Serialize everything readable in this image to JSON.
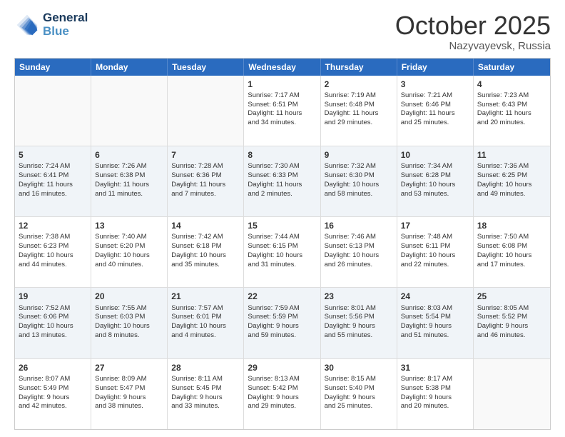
{
  "logo": {
    "line1": "General",
    "line2": "Blue"
  },
  "title": "October 2025",
  "location": "Nazyvayevsk, Russia",
  "days_of_week": [
    "Sunday",
    "Monday",
    "Tuesday",
    "Wednesday",
    "Thursday",
    "Friday",
    "Saturday"
  ],
  "weeks": [
    [
      {
        "day": "",
        "text": ""
      },
      {
        "day": "",
        "text": ""
      },
      {
        "day": "",
        "text": ""
      },
      {
        "day": "1",
        "text": "Sunrise: 7:17 AM\nSunset: 6:51 PM\nDaylight: 11 hours\nand 34 minutes."
      },
      {
        "day": "2",
        "text": "Sunrise: 7:19 AM\nSunset: 6:48 PM\nDaylight: 11 hours\nand 29 minutes."
      },
      {
        "day": "3",
        "text": "Sunrise: 7:21 AM\nSunset: 6:46 PM\nDaylight: 11 hours\nand 25 minutes."
      },
      {
        "day": "4",
        "text": "Sunrise: 7:23 AM\nSunset: 6:43 PM\nDaylight: 11 hours\nand 20 minutes."
      }
    ],
    [
      {
        "day": "5",
        "text": "Sunrise: 7:24 AM\nSunset: 6:41 PM\nDaylight: 11 hours\nand 16 minutes."
      },
      {
        "day": "6",
        "text": "Sunrise: 7:26 AM\nSunset: 6:38 PM\nDaylight: 11 hours\nand 11 minutes."
      },
      {
        "day": "7",
        "text": "Sunrise: 7:28 AM\nSunset: 6:36 PM\nDaylight: 11 hours\nand 7 minutes."
      },
      {
        "day": "8",
        "text": "Sunrise: 7:30 AM\nSunset: 6:33 PM\nDaylight: 11 hours\nand 2 minutes."
      },
      {
        "day": "9",
        "text": "Sunrise: 7:32 AM\nSunset: 6:30 PM\nDaylight: 10 hours\nand 58 minutes."
      },
      {
        "day": "10",
        "text": "Sunrise: 7:34 AM\nSunset: 6:28 PM\nDaylight: 10 hours\nand 53 minutes."
      },
      {
        "day": "11",
        "text": "Sunrise: 7:36 AM\nSunset: 6:25 PM\nDaylight: 10 hours\nand 49 minutes."
      }
    ],
    [
      {
        "day": "12",
        "text": "Sunrise: 7:38 AM\nSunset: 6:23 PM\nDaylight: 10 hours\nand 44 minutes."
      },
      {
        "day": "13",
        "text": "Sunrise: 7:40 AM\nSunset: 6:20 PM\nDaylight: 10 hours\nand 40 minutes."
      },
      {
        "day": "14",
        "text": "Sunrise: 7:42 AM\nSunset: 6:18 PM\nDaylight: 10 hours\nand 35 minutes."
      },
      {
        "day": "15",
        "text": "Sunrise: 7:44 AM\nSunset: 6:15 PM\nDaylight: 10 hours\nand 31 minutes."
      },
      {
        "day": "16",
        "text": "Sunrise: 7:46 AM\nSunset: 6:13 PM\nDaylight: 10 hours\nand 26 minutes."
      },
      {
        "day": "17",
        "text": "Sunrise: 7:48 AM\nSunset: 6:11 PM\nDaylight: 10 hours\nand 22 minutes."
      },
      {
        "day": "18",
        "text": "Sunrise: 7:50 AM\nSunset: 6:08 PM\nDaylight: 10 hours\nand 17 minutes."
      }
    ],
    [
      {
        "day": "19",
        "text": "Sunrise: 7:52 AM\nSunset: 6:06 PM\nDaylight: 10 hours\nand 13 minutes."
      },
      {
        "day": "20",
        "text": "Sunrise: 7:55 AM\nSunset: 6:03 PM\nDaylight: 10 hours\nand 8 minutes."
      },
      {
        "day": "21",
        "text": "Sunrise: 7:57 AM\nSunset: 6:01 PM\nDaylight: 10 hours\nand 4 minutes."
      },
      {
        "day": "22",
        "text": "Sunrise: 7:59 AM\nSunset: 5:59 PM\nDaylight: 9 hours\nand 59 minutes."
      },
      {
        "day": "23",
        "text": "Sunrise: 8:01 AM\nSunset: 5:56 PM\nDaylight: 9 hours\nand 55 minutes."
      },
      {
        "day": "24",
        "text": "Sunrise: 8:03 AM\nSunset: 5:54 PM\nDaylight: 9 hours\nand 51 minutes."
      },
      {
        "day": "25",
        "text": "Sunrise: 8:05 AM\nSunset: 5:52 PM\nDaylight: 9 hours\nand 46 minutes."
      }
    ],
    [
      {
        "day": "26",
        "text": "Sunrise: 8:07 AM\nSunset: 5:49 PM\nDaylight: 9 hours\nand 42 minutes."
      },
      {
        "day": "27",
        "text": "Sunrise: 8:09 AM\nSunset: 5:47 PM\nDaylight: 9 hours\nand 38 minutes."
      },
      {
        "day": "28",
        "text": "Sunrise: 8:11 AM\nSunset: 5:45 PM\nDaylight: 9 hours\nand 33 minutes."
      },
      {
        "day": "29",
        "text": "Sunrise: 8:13 AM\nSunset: 5:42 PM\nDaylight: 9 hours\nand 29 minutes."
      },
      {
        "day": "30",
        "text": "Sunrise: 8:15 AM\nSunset: 5:40 PM\nDaylight: 9 hours\nand 25 minutes."
      },
      {
        "day": "31",
        "text": "Sunrise: 8:17 AM\nSunset: 5:38 PM\nDaylight: 9 hours\nand 20 minutes."
      },
      {
        "day": "",
        "text": ""
      }
    ]
  ]
}
